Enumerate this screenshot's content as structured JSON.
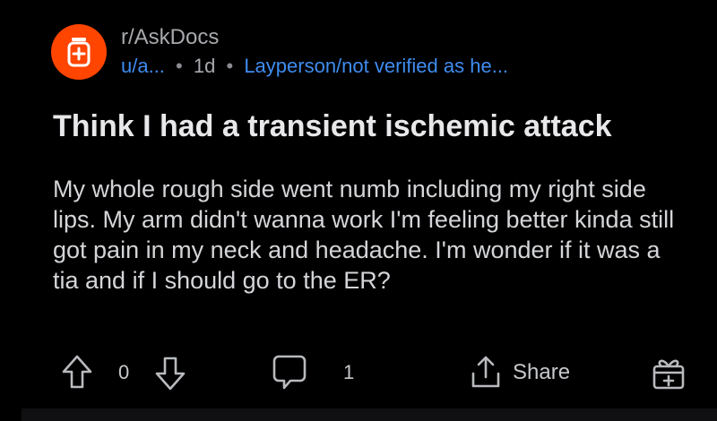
{
  "post": {
    "subreddit": "r/AskDocs",
    "username": "u/a...",
    "separator": "•",
    "age": "1d",
    "flair": "Layperson/not verified as he...",
    "title": "Think I had a transient ischemic attack",
    "body": "My whole rough side went numb including my right side lips. My arm didn't wanna work I'm feeling better kinda still got pain in my neck and headache. I'm wonder if it was a tia and if I should go to the ER?"
  },
  "actions": {
    "vote_count": "0",
    "comment_count": "1",
    "share_label": "Share"
  },
  "icons": {
    "avatar": "subreddit-avatar-icon",
    "upvote": "arrow-up-icon",
    "downvote": "arrow-down-icon",
    "comment": "comment-bubble-icon",
    "share": "share-icon",
    "award": "award-gift-icon"
  },
  "colors": {
    "background": "#000000",
    "avatar": "#ff4500",
    "link": "#3f8cf0",
    "title": "#e8e8ea",
    "body": "#d4d5d8",
    "muted": "#a7a9ad"
  }
}
